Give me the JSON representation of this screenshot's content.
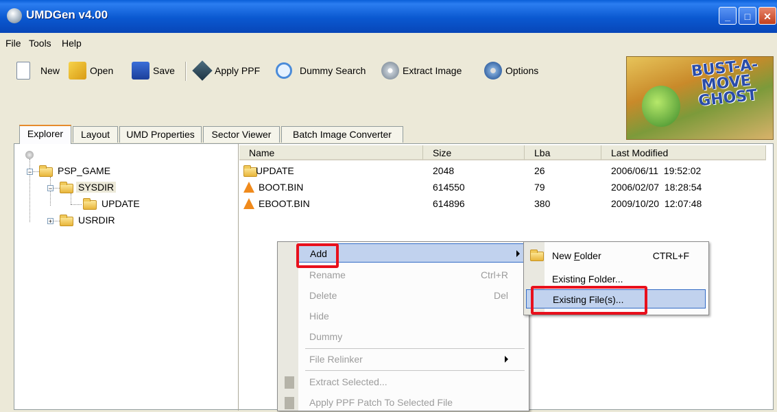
{
  "window": {
    "title": "UMDGen v4.00",
    "icon": "umdgen-disc-icon"
  },
  "menubar": [
    "File",
    "Tools",
    "Help"
  ],
  "toolbar": {
    "new": "New",
    "open": "Open",
    "save": "Save",
    "apply_ppf": "Apply PPF",
    "dummy_search": "Dummy Search",
    "extract_image": "Extract Image",
    "options": "Options"
  },
  "banner": {
    "logo_text": "BUST-A-MOVE GHOST"
  },
  "tabs": [
    "Explorer",
    "Layout",
    "UMD Properties",
    "Sector Viewer",
    "Batch Image Converter"
  ],
  "tree": {
    "nodes": [
      {
        "label": "PSP_GAME",
        "expander": "−"
      },
      {
        "label": "SYSDIR",
        "expander": "−"
      },
      {
        "label": "UPDATE",
        "expander": ""
      },
      {
        "label": "USRDIR",
        "expander": "+"
      }
    ]
  },
  "list": {
    "columns": [
      "Name",
      "Size",
      "Lba",
      "Last Modified"
    ],
    "rows": [
      {
        "name": "UPDATE",
        "size": "2048",
        "lba": "26",
        "modified": "2006/06/11  19:52:02",
        "icon": "folder-icon"
      },
      {
        "name": "BOOT.BIN",
        "size": "614550",
        "lba": "79",
        "modified": "2006/02/07  18:28:54",
        "icon": "vlc-file-icon"
      },
      {
        "name": "EBOOT.BIN",
        "size": "614896",
        "lba": "380",
        "modified": "2009/10/20  12:07:48",
        "icon": "vlc-file-icon"
      }
    ]
  },
  "context_menu": {
    "add": "Add",
    "rename": "Rename",
    "rename_shortcut": "Ctrl+R",
    "delete": "Delete",
    "delete_shortcut": "Del",
    "hide": "Hide",
    "dummy": "Dummy",
    "file_relinker": "File Relinker",
    "extract_selected": "Extract Selected...",
    "apply_ppf_patch": "Apply PPF Patch To Selected File"
  },
  "submenu": {
    "new_folder_pre": "New ",
    "new_folder_ul": "F",
    "new_folder_post": "older",
    "new_folder_shortcut": "CTRL+F",
    "existing_folder": "Existing Folder...",
    "existing_files": "Existing File(s)..."
  },
  "colors": {
    "titlebar": "#0a58d0",
    "highlight": "#c1d2ee",
    "annotation_red": "#e8101c",
    "tab_active_accent": "#e68b2c"
  }
}
